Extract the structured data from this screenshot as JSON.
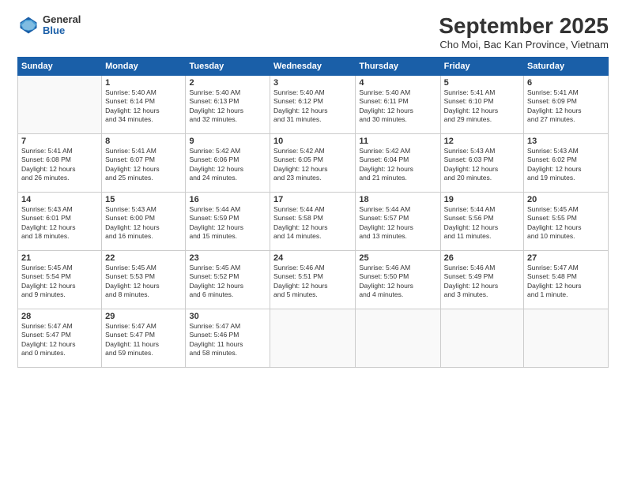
{
  "header": {
    "logo": {
      "general": "General",
      "blue": "Blue"
    },
    "title": "September 2025",
    "subtitle": "Cho Moi, Bac Kan Province, Vietnam"
  },
  "weekdays": [
    "Sunday",
    "Monday",
    "Tuesday",
    "Wednesday",
    "Thursday",
    "Friday",
    "Saturday"
  ],
  "weeks": [
    [
      {
        "num": "",
        "info": ""
      },
      {
        "num": "1",
        "info": "Sunrise: 5:40 AM\nSunset: 6:14 PM\nDaylight: 12 hours\nand 34 minutes."
      },
      {
        "num": "2",
        "info": "Sunrise: 5:40 AM\nSunset: 6:13 PM\nDaylight: 12 hours\nand 32 minutes."
      },
      {
        "num": "3",
        "info": "Sunrise: 5:40 AM\nSunset: 6:12 PM\nDaylight: 12 hours\nand 31 minutes."
      },
      {
        "num": "4",
        "info": "Sunrise: 5:40 AM\nSunset: 6:11 PM\nDaylight: 12 hours\nand 30 minutes."
      },
      {
        "num": "5",
        "info": "Sunrise: 5:41 AM\nSunset: 6:10 PM\nDaylight: 12 hours\nand 29 minutes."
      },
      {
        "num": "6",
        "info": "Sunrise: 5:41 AM\nSunset: 6:09 PM\nDaylight: 12 hours\nand 27 minutes."
      }
    ],
    [
      {
        "num": "7",
        "info": "Sunrise: 5:41 AM\nSunset: 6:08 PM\nDaylight: 12 hours\nand 26 minutes."
      },
      {
        "num": "8",
        "info": "Sunrise: 5:41 AM\nSunset: 6:07 PM\nDaylight: 12 hours\nand 25 minutes."
      },
      {
        "num": "9",
        "info": "Sunrise: 5:42 AM\nSunset: 6:06 PM\nDaylight: 12 hours\nand 24 minutes."
      },
      {
        "num": "10",
        "info": "Sunrise: 5:42 AM\nSunset: 6:05 PM\nDaylight: 12 hours\nand 23 minutes."
      },
      {
        "num": "11",
        "info": "Sunrise: 5:42 AM\nSunset: 6:04 PM\nDaylight: 12 hours\nand 21 minutes."
      },
      {
        "num": "12",
        "info": "Sunrise: 5:43 AM\nSunset: 6:03 PM\nDaylight: 12 hours\nand 20 minutes."
      },
      {
        "num": "13",
        "info": "Sunrise: 5:43 AM\nSunset: 6:02 PM\nDaylight: 12 hours\nand 19 minutes."
      }
    ],
    [
      {
        "num": "14",
        "info": "Sunrise: 5:43 AM\nSunset: 6:01 PM\nDaylight: 12 hours\nand 18 minutes."
      },
      {
        "num": "15",
        "info": "Sunrise: 5:43 AM\nSunset: 6:00 PM\nDaylight: 12 hours\nand 16 minutes."
      },
      {
        "num": "16",
        "info": "Sunrise: 5:44 AM\nSunset: 5:59 PM\nDaylight: 12 hours\nand 15 minutes."
      },
      {
        "num": "17",
        "info": "Sunrise: 5:44 AM\nSunset: 5:58 PM\nDaylight: 12 hours\nand 14 minutes."
      },
      {
        "num": "18",
        "info": "Sunrise: 5:44 AM\nSunset: 5:57 PM\nDaylight: 12 hours\nand 13 minutes."
      },
      {
        "num": "19",
        "info": "Sunrise: 5:44 AM\nSunset: 5:56 PM\nDaylight: 12 hours\nand 11 minutes."
      },
      {
        "num": "20",
        "info": "Sunrise: 5:45 AM\nSunset: 5:55 PM\nDaylight: 12 hours\nand 10 minutes."
      }
    ],
    [
      {
        "num": "21",
        "info": "Sunrise: 5:45 AM\nSunset: 5:54 PM\nDaylight: 12 hours\nand 9 minutes."
      },
      {
        "num": "22",
        "info": "Sunrise: 5:45 AM\nSunset: 5:53 PM\nDaylight: 12 hours\nand 8 minutes."
      },
      {
        "num": "23",
        "info": "Sunrise: 5:45 AM\nSunset: 5:52 PM\nDaylight: 12 hours\nand 6 minutes."
      },
      {
        "num": "24",
        "info": "Sunrise: 5:46 AM\nSunset: 5:51 PM\nDaylight: 12 hours\nand 5 minutes."
      },
      {
        "num": "25",
        "info": "Sunrise: 5:46 AM\nSunset: 5:50 PM\nDaylight: 12 hours\nand 4 minutes."
      },
      {
        "num": "26",
        "info": "Sunrise: 5:46 AM\nSunset: 5:49 PM\nDaylight: 12 hours\nand 3 minutes."
      },
      {
        "num": "27",
        "info": "Sunrise: 5:47 AM\nSunset: 5:48 PM\nDaylight: 12 hours\nand 1 minute."
      }
    ],
    [
      {
        "num": "28",
        "info": "Sunrise: 5:47 AM\nSunset: 5:47 PM\nDaylight: 12 hours\nand 0 minutes."
      },
      {
        "num": "29",
        "info": "Sunrise: 5:47 AM\nSunset: 5:47 PM\nDaylight: 11 hours\nand 59 minutes."
      },
      {
        "num": "30",
        "info": "Sunrise: 5:47 AM\nSunset: 5:46 PM\nDaylight: 11 hours\nand 58 minutes."
      },
      {
        "num": "",
        "info": ""
      },
      {
        "num": "",
        "info": ""
      },
      {
        "num": "",
        "info": ""
      },
      {
        "num": "",
        "info": ""
      }
    ]
  ]
}
